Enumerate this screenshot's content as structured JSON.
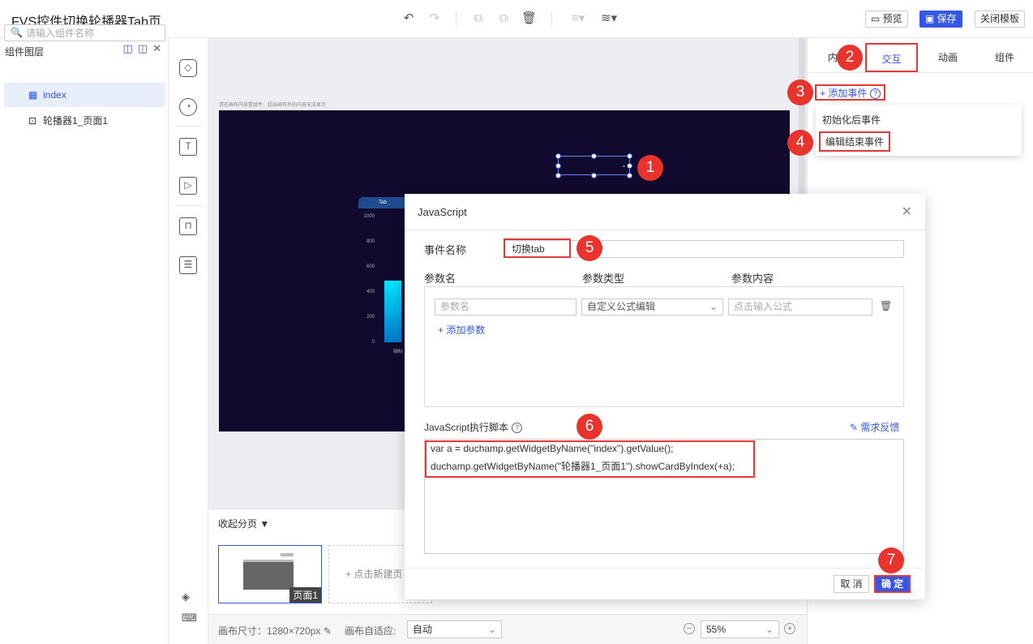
{
  "app": {
    "title": "FVS控件切换轮播器Tab页"
  },
  "toolbar": {
    "undo_icon": "undo-icon",
    "redo_icon": "redo-icon",
    "preview": "预览",
    "save": "保存",
    "close_template": "关闭模板"
  },
  "layers": {
    "title": "组件图层",
    "search_placeholder": "请输入组件名称",
    "items": [
      {
        "label": "index",
        "icon": "widget-icon"
      },
      {
        "label": "轮播器1_页面1",
        "icon": "carousel-icon"
      }
    ]
  },
  "canvas": {
    "hint": "请在画布内放置组件，超出画布外的内容无法显示",
    "chart_title": "Tab",
    "y_ticks": [
      "1000",
      "800",
      "600",
      "400",
      "200",
      "0"
    ],
    "x_label": "轴标"
  },
  "right_panel": {
    "tabs": [
      "内容",
      "交互",
      "动画",
      "组件"
    ],
    "active_tab": "交互",
    "add_event": "添加事件",
    "events": [
      "初始化后事件",
      "编辑结束事件"
    ]
  },
  "modal": {
    "title": "JavaScript",
    "event_name_label": "事件名称",
    "event_name_value": "切换tab",
    "param_name_header": "参数名",
    "param_type_header": "参数类型",
    "param_content_header": "参数内容",
    "param_name_placeholder": "参数名",
    "param_type_value": "自定义公式编辑",
    "param_content_placeholder": "点击输入公式",
    "add_param": "添加参数",
    "script_label": "JavaScript执行脚本",
    "feedback": "需求反馈",
    "script_lines": [
      "var a = duchamp.getWidgetByName(\"index\").getValue();",
      "duchamp.getWidgetByName(\"轮播器1_页面1\").showCardByIndex(+a);"
    ],
    "cancel": "取 消",
    "ok": "确 定"
  },
  "pages": {
    "collapse": "收起分页",
    "page1": "页面1",
    "new_page": "点击新建页"
  },
  "bottombar": {
    "canvas_size_label": "画布尺寸：",
    "canvas_size": "1280×720px",
    "fit_label": "画布自适应:",
    "fit_value": "自动",
    "zoom": "55%"
  },
  "badges": [
    "1",
    "2",
    "3",
    "4",
    "5",
    "6",
    "7"
  ],
  "colors": {
    "accent": "#3457e6",
    "highlight": "#e23a3a",
    "badge": "#e8342c",
    "canvas_bg": "#120a2e"
  }
}
